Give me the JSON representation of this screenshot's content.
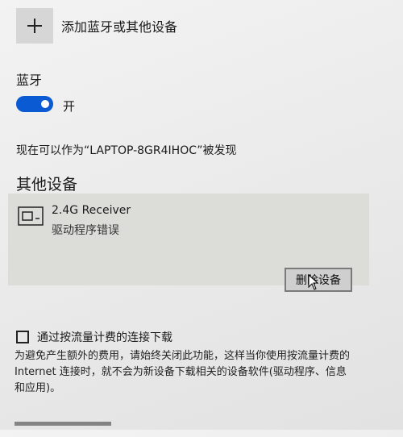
{
  "add_device": {
    "label": "添加蓝牙或其他设备",
    "icon": "plus-icon"
  },
  "bluetooth": {
    "heading": "蓝牙",
    "toggle_state_label": "开",
    "toggle_on": true,
    "accent_color": "#0a5bd3",
    "discoverable_text": "现在可以作为“LAPTOP-8GR4IHOC”被发现"
  },
  "other_devices": {
    "heading": "其他设备",
    "items": [
      {
        "name": "2.4G Receiver",
        "status": "驱动程序错误",
        "icon": "device-icon",
        "remove_label": "删除设备"
      }
    ]
  },
  "metered": {
    "checked": false,
    "label": "通过按流量计费的连接下载",
    "description": "为避免产生额外的费用，请始终关闭此功能，这样当你使用按流量计费的 Internet 连接时，就不会为新设备下载相关的设备软件(驱动程序、信息和应用)。"
  }
}
